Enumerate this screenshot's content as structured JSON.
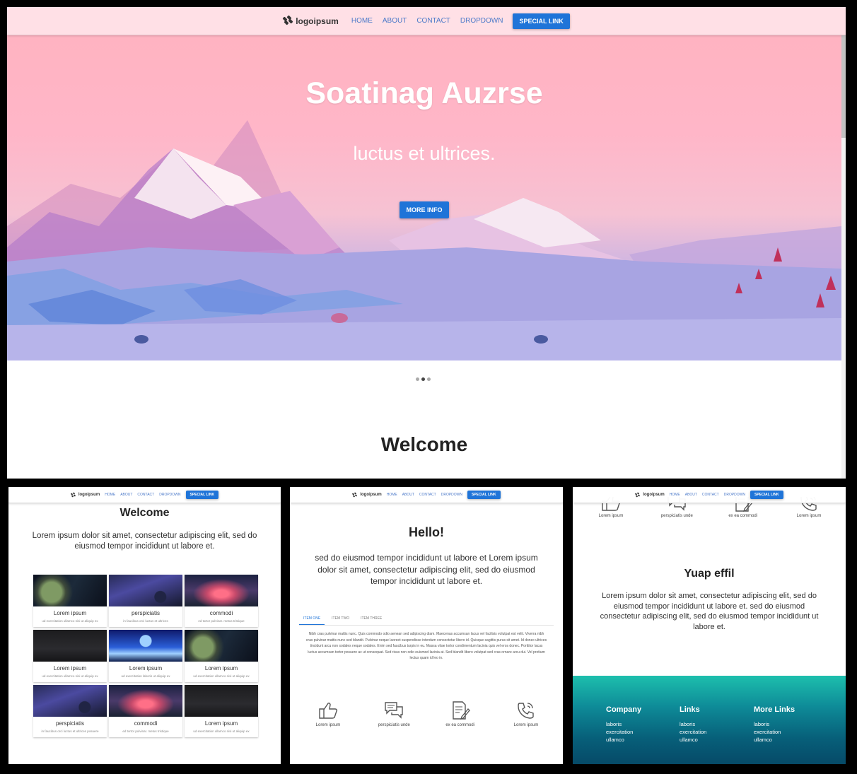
{
  "nav": {
    "logo": "logoipsum",
    "links": [
      "HOME",
      "ABOUT",
      "CONTACT",
      "DROPDOWN"
    ],
    "special": "SPECIAL LINK"
  },
  "hero": {
    "title": "Soatinag Auzrse",
    "subtitle": "luctus et ultrices.",
    "button": "MORE INFO"
  },
  "carousel": {
    "slides": 3,
    "active": 2
  },
  "welcome": {
    "title": "Welcome",
    "text": "Lorem ipsum dolor sit amet, consectetur adipiscing elit, sed do eiusmod tempor incididunt ut labore et."
  },
  "cards": [
    {
      "title": "Lorem ipsum",
      "text": "ud exercitation ullamco nisi ut aliquip ex",
      "image": "planet"
    },
    {
      "title": "perspiciatis",
      "text": "in faucibus orci luctus et ultrices",
      "image": "space"
    },
    {
      "title": "commodi",
      "text": "ed tortor pulvinar. metus tristique",
      "image": "sunset"
    },
    {
      "title": "Lorem ipsum",
      "text": "ud exercitation ullamco nisi ut aliquip ex",
      "image": "dark"
    },
    {
      "title": "Lorem ipsum",
      "text": "ud exercitation laboris ut aliquip ex",
      "image": "blue"
    },
    {
      "title": "Lorem ipsum",
      "text": "ud exercitation ullamco nisi ut aliquip ex",
      "image": "planet"
    },
    {
      "title": "perspiciatis",
      "text": "in faucibus orci luctus et ultrices posuere",
      "image": "space"
    },
    {
      "title": "commodi",
      "text": "ed tortor pulvinar. metus tristique",
      "image": "sunset"
    },
    {
      "title": "Lorem ipsum",
      "text": "ud exercitation ullamco nisi ut aliquip ex",
      "image": "dark"
    }
  ],
  "hello": {
    "title": "Hello!",
    "text": "sed do eiusmod tempor incididunt ut labore et Lorem ipsum dolor sit amet, consectetur adipiscing elit, sed do eiusmod tempor incididunt ut labore et."
  },
  "tabs": {
    "items": [
      "ITEM ONE",
      "ITEM TWO",
      "ITEM THREE"
    ],
    "content": "Nibh cras pulvinar mattis nunc. Quis commodo odio aenean sed adipiscing diam. Maecenas accumsan lacus vel facilisis volutpat est velit. Viverra nibh cras pulvinar mattis nunc sed blandit. Pulvinar neque laoreet suspendisse interdum consectetur libero id. Quisque sagittis purus sit amet. Id donec ultrices tincidunt arcu non sodales neque sodales. Enim sed faucibus turpis in eu. Massa vitae tortor condimentum lacinia quis vel eros donec. Porttitor lacus luctus accumsan tortor posuere ac ut consequat. Sed risus non odio euismod lacinia at. Sed blandit libero volutpat sed cras ornare arcu dui. Vel pretium lectus quam id leo in."
  },
  "features": [
    {
      "icon": "thumbs-up-icon",
      "label": "Lorem ipsum"
    },
    {
      "icon": "chat-bubbles-icon",
      "label": "perspiciatis unde"
    },
    {
      "icon": "document-edit-icon",
      "label": "ex ea commodi"
    },
    {
      "icon": "phone-icon",
      "label": "Lorem ipsum"
    }
  ],
  "yuap": {
    "title": "Yuap effil",
    "text": "Lorem ipsum dolor sit amet, consectetur adipiscing elit, sed do eiusmod tempor incididunt ut labore et. sed do eiusmod consectetur adipiscing elit, sed do eiusmod tempor incididunt ut labore et."
  },
  "footer": {
    "columns": [
      {
        "title": "Company",
        "links": [
          "laboris",
          "exercitation",
          "ullamco"
        ]
      },
      {
        "title": "Links",
        "links": [
          "laboris",
          "exercitation",
          "ullamco"
        ]
      },
      {
        "title": "More Links",
        "links": [
          "laboris",
          "exercitation",
          "ullamco"
        ]
      }
    ]
  },
  "colors": {
    "accent": "#1f74d8",
    "nav_link": "#4b79c9",
    "nav_bg": "#ffe0e6",
    "footer_teal": "#0e8b98"
  }
}
